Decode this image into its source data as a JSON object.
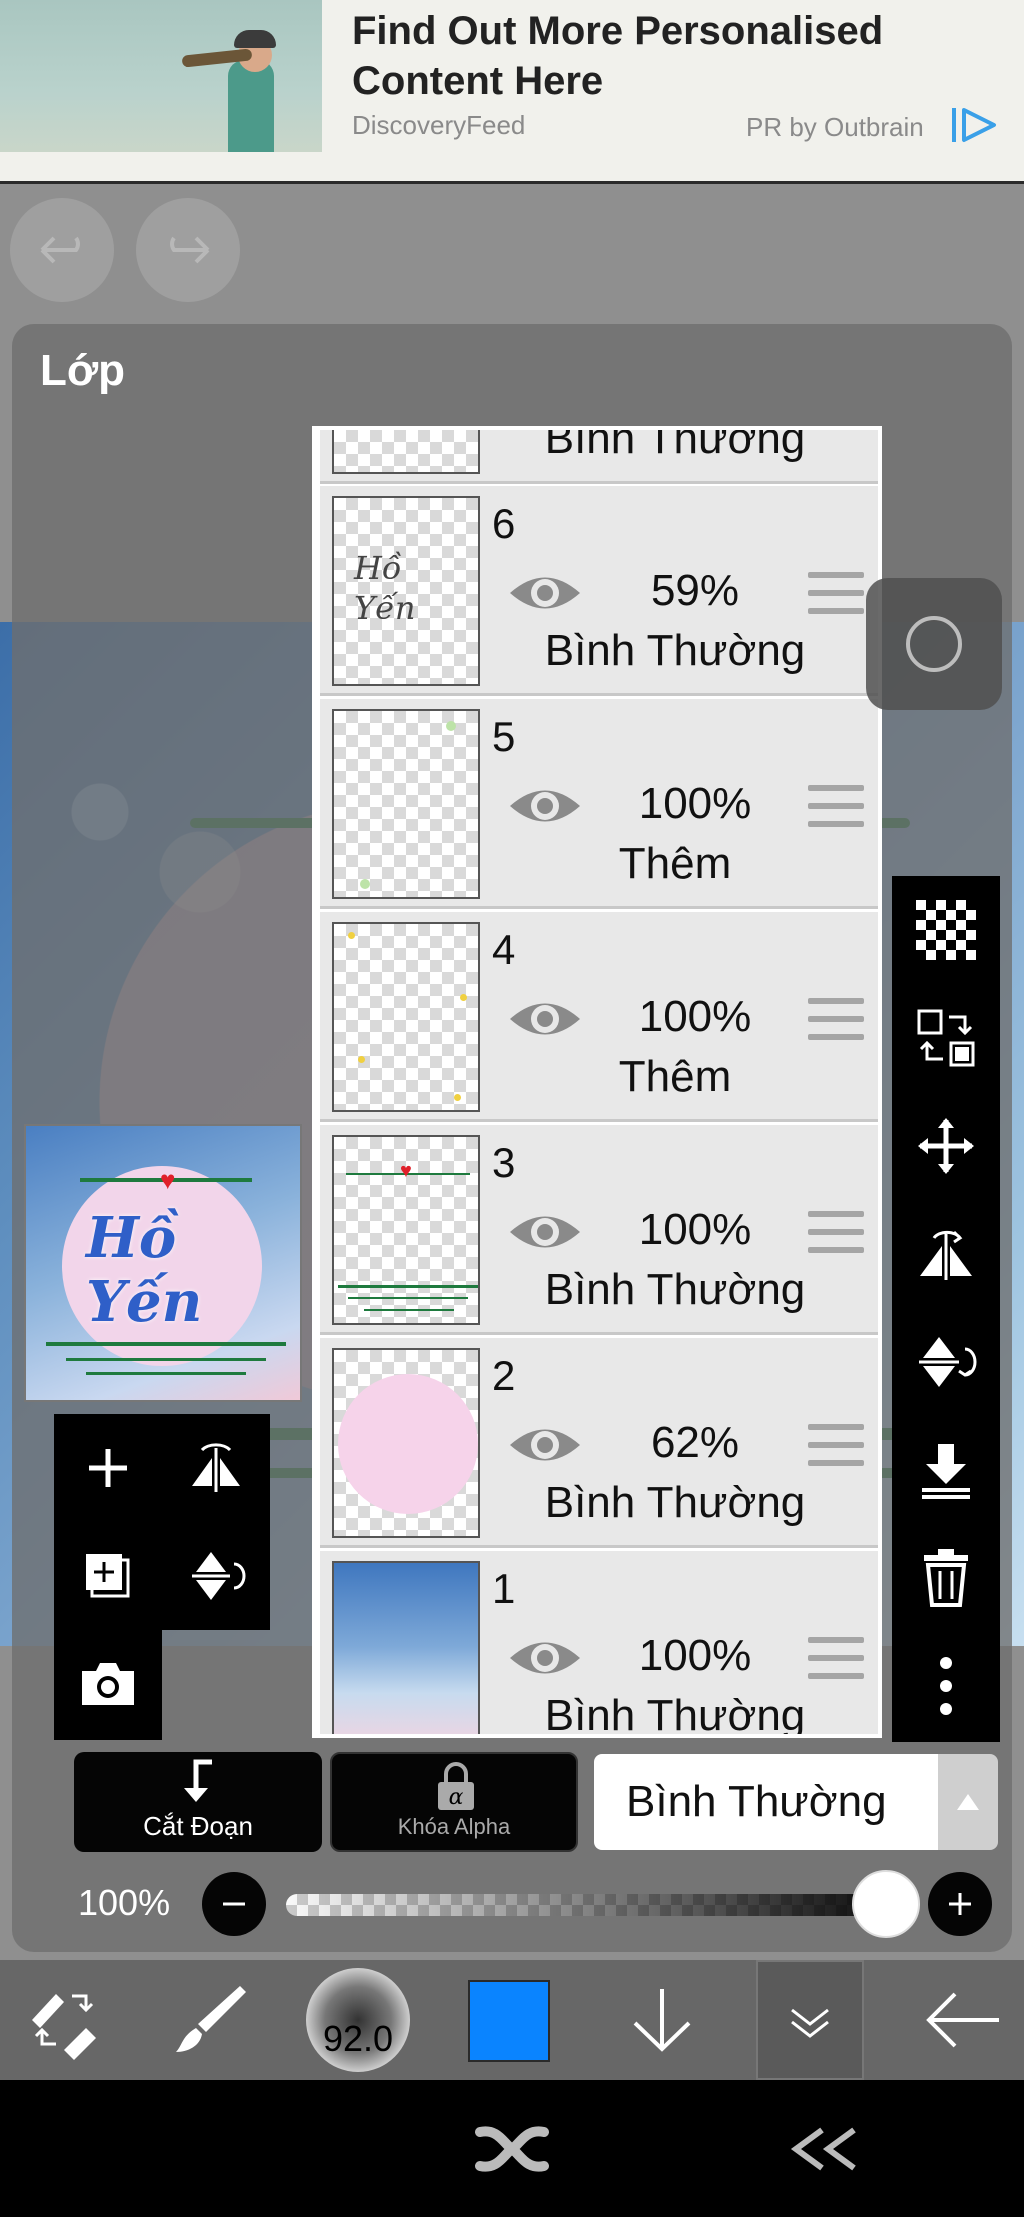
{
  "ad": {
    "title": "Find Out More Personalised Content Here",
    "source": "DiscoveryFeed",
    "sponsor": "PR by Outbrain",
    "logo_icon": "outbrain-logo-icon"
  },
  "toolbar_top": {
    "undo_icon": "undo-icon",
    "redo_icon": "redo-icon"
  },
  "panel": {
    "title": "Lớp"
  },
  "preview": {
    "text": "Hồ Yến"
  },
  "layers": [
    {
      "number": "",
      "opacity": "",
      "blend": "Bình Thường"
    },
    {
      "number": "6",
      "opacity": "59%",
      "blend": "Bình Thường",
      "thumb_text": "Hồ Yến"
    },
    {
      "number": "5",
      "opacity": "100%",
      "blend": "Thêm"
    },
    {
      "number": "4",
      "opacity": "100%",
      "blend": "Thêm"
    },
    {
      "number": "3",
      "opacity": "100%",
      "blend": "Bình Thường"
    },
    {
      "number": "2",
      "opacity": "62%",
      "blend": "Bình Thường"
    },
    {
      "number": "1",
      "opacity": "100%",
      "blend": "Bình Thường"
    }
  ],
  "bottom_controls": {
    "clipping_label": "Cắt Đoạn",
    "alpha_lock_label": "Khóa Alpha",
    "blend_mode": "Bình Thường"
  },
  "opacity_slider": {
    "label": "100%",
    "value": 1.0
  },
  "bottom_bar": {
    "brush_size": "92.0",
    "color": "#0a84ff"
  },
  "colors": {
    "accent_blue": "#0a84ff",
    "panel_bg": "#6e6e6e",
    "toolbar_bg": "#000000"
  }
}
